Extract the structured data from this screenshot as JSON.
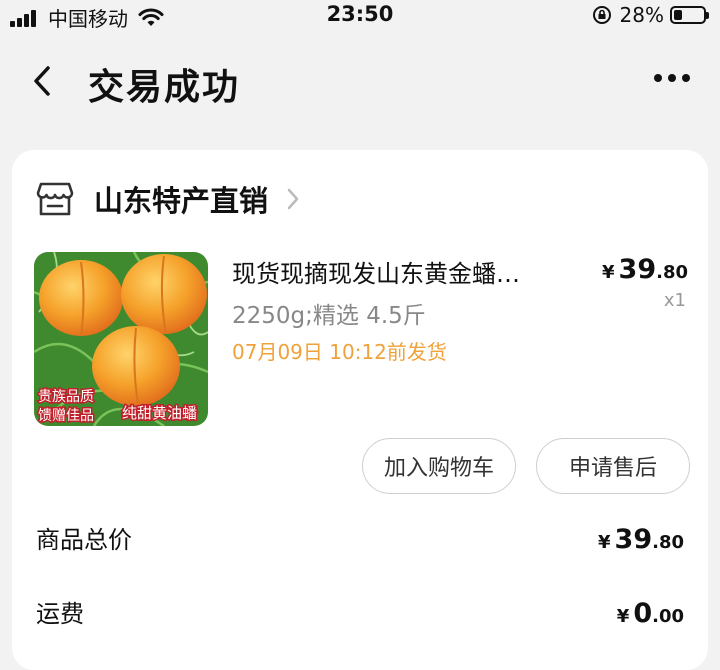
{
  "status_bar": {
    "carrier": "中国移动",
    "time": "23:50",
    "battery_percent": "28%",
    "battery_level": 0.28
  },
  "header": {
    "title": "交易成功",
    "back_icon": "chevron-left-icon",
    "more_icon": "more-dots-icon"
  },
  "shop": {
    "name": "山东特产直销",
    "icon": "store-icon"
  },
  "product": {
    "title": "现货现摘现发山东黄金蟠…",
    "spec": "2250g;精选 4.5斤",
    "ship_time": "07月09日 10:12前发货",
    "price_symbol": "¥",
    "price_int": "39",
    "price_dec": ".80",
    "quantity": "x1",
    "image_caption_left_1": "贵族品质",
    "image_caption_left_2": "馈赠佳品",
    "image_caption_right": "纯甜黄油蟠"
  },
  "actions": {
    "add_to_cart": "加入购物车",
    "request_after_sale": "申请售后"
  },
  "summary": {
    "items": [
      {
        "label": "商品总价",
        "symbol": "¥",
        "int": "39",
        "dec": ".80"
      },
      {
        "label": "运费",
        "symbol": "¥",
        "int": "0",
        "dec": ".00"
      }
    ]
  },
  "colors": {
    "accent_orange": "#f0a23a",
    "background": "#f2f2f2",
    "card": "#ffffff"
  }
}
